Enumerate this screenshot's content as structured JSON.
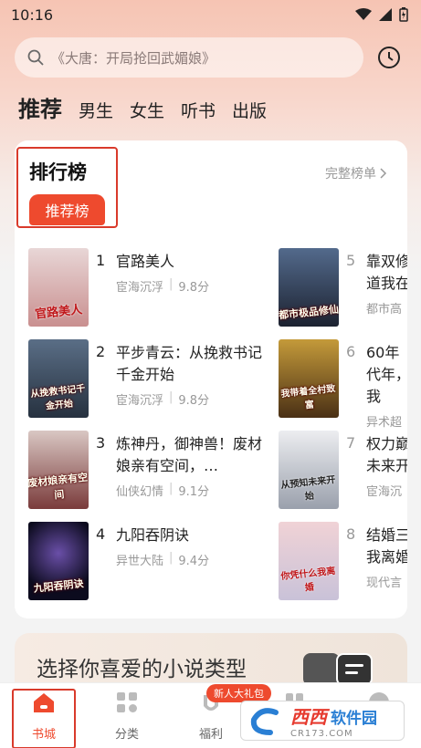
{
  "status": {
    "time": "10:16"
  },
  "search": {
    "placeholder": "《大唐：开局抢回武媚娘》"
  },
  "tabs": [
    {
      "label": "推荐"
    },
    {
      "label": "男生"
    },
    {
      "label": "女生"
    },
    {
      "label": "听书"
    },
    {
      "label": "出版"
    }
  ],
  "ranking": {
    "title": "排行榜",
    "pill": "推荐榜",
    "more": "完整榜单",
    "books": [
      {
        "rank": "1",
        "name": "官路美人",
        "category": "宦海沉浮",
        "score": "9.8分",
        "cover_text": "官路美人",
        "cover_colors": [
          "#e8d6d6",
          "#c98f8f"
        ]
      },
      {
        "rank": "2",
        "name": "平步青云：从挽救书记千金开始",
        "category": "宦海沉浮",
        "score": "9.8分",
        "cover_text": "从挽救书记千金开始",
        "cover_colors": [
          "#5a6e86",
          "#26313f"
        ]
      },
      {
        "rank": "3",
        "name": "炼神丹，御神兽！废材娘亲有空间，…",
        "category": "仙侠幻情",
        "score": "9.1分",
        "cover_text": "废材娘亲有空间",
        "cover_colors": [
          "#d9c7c3",
          "#7a3b3b"
        ]
      },
      {
        "rank": "4",
        "name": "九阳吞阴诀",
        "category": "异世大陆",
        "score": "9.4分",
        "cover_text": "九阳吞阴诀",
        "cover_colors": [
          "#2a2350",
          "#0c0b1e"
        ]
      },
      {
        "rank": "5",
        "name": "靠双修道我在",
        "category": "都市高",
        "score": "",
        "cover_text": "都市极品修仙",
        "cover_colors": [
          "#536a8c",
          "#1c2230"
        ]
      },
      {
        "rank": "6",
        "name": "60年代年，我",
        "category": "异术超",
        "score": "",
        "cover_text": "我带着全村致富",
        "cover_colors": [
          "#c49a3a",
          "#4a3015"
        ]
      },
      {
        "rank": "7",
        "name": "权力巅未来开",
        "category": "宦海沉",
        "score": "",
        "cover_text": "从预知未来开始",
        "cover_colors": [
          "#ecedf0",
          "#9aa0ac"
        ]
      },
      {
        "rank": "8",
        "name": "结婚三我离婚",
        "category": "现代言",
        "score": "",
        "cover_text": "你凭什么我离婚",
        "cover_colors": [
          "#f0d2d6",
          "#c9c2d8"
        ]
      }
    ]
  },
  "banner": {
    "text": "选择你喜爱的小说类型"
  },
  "nav": [
    {
      "label": "书城"
    },
    {
      "label": "分类"
    },
    {
      "label": "福利"
    },
    {
      "label": "书架"
    },
    {
      "label": "我的"
    }
  ],
  "gift_badge": "新人大礼包",
  "watermark": {
    "brand": "西西",
    "sub": "软件园",
    "url": "CR173.COM"
  },
  "colors": {
    "accent": "#ee4a2e",
    "highlight_border": "#d93a2b"
  }
}
